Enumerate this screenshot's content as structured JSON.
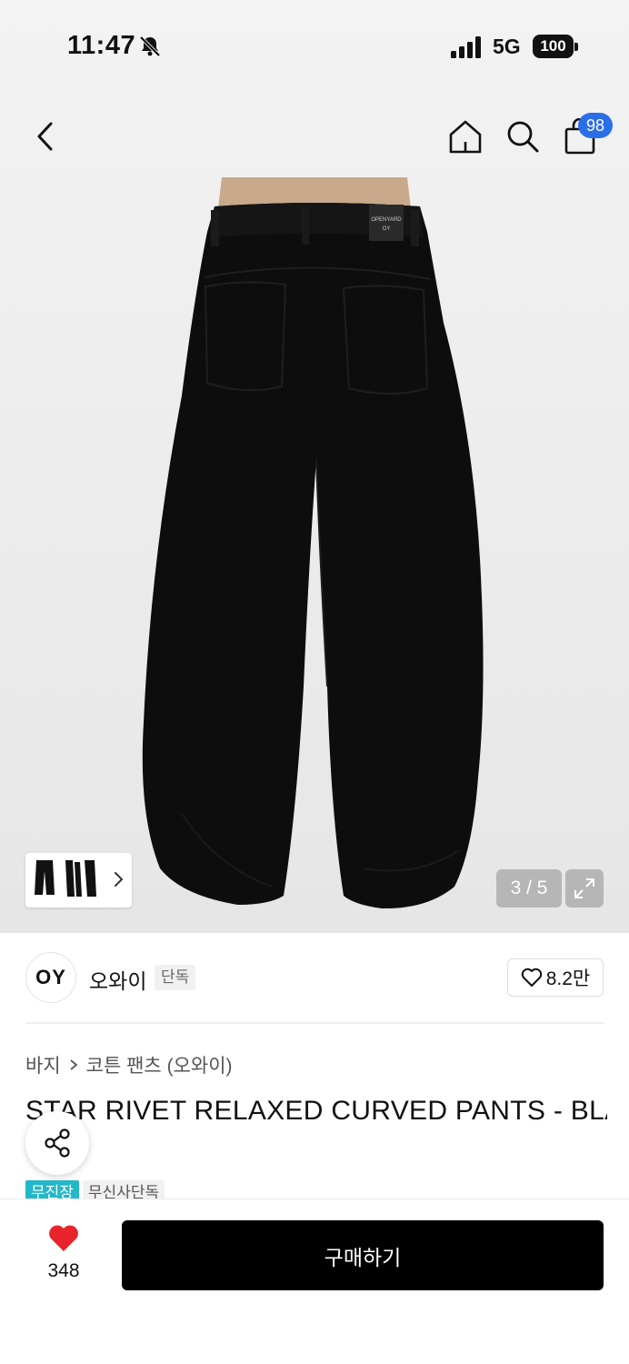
{
  "status_bar": {
    "time": "11:47",
    "network": "5G",
    "battery": "100"
  },
  "nav": {
    "cart_count": "98"
  },
  "gallery": {
    "counter": "3 / 5",
    "label_text": "OPENYARD",
    "label_subtext": "OY"
  },
  "brand": {
    "logo_text": "OY",
    "name": "오와이",
    "tag": "단독",
    "likes": "8.2만"
  },
  "breadcrumb": {
    "category": "바지",
    "subcategory": "코튼 팬츠 (오와이)"
  },
  "product": {
    "title": "STAR RIVET RELAXED CURVED PANTS - BLACK"
  },
  "tags": [
    "무진장",
    "무신사단독"
  ],
  "bottom_bar": {
    "heart_count": "348",
    "buy_label": "구매하기"
  },
  "colors": {
    "cart_badge": "#2b6fe8",
    "tag_primary": "#21b8c9",
    "heart": "#e8232b",
    "buy_button": "#000000"
  }
}
